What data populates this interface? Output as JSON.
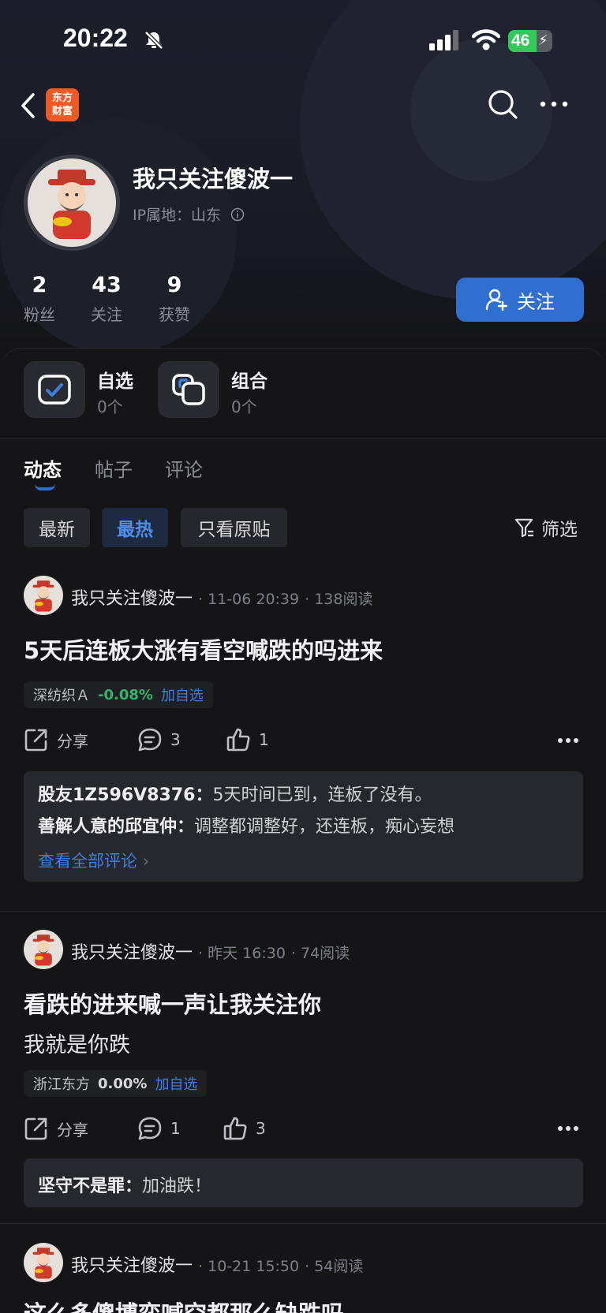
{
  "status_bar": {
    "time": "20:22",
    "battery": "46"
  },
  "nav": {
    "logo_line1": "东方",
    "logo_line2": "财富"
  },
  "profile": {
    "name": "我只关注傻波一",
    "ip_label": "IP属地：山东",
    "stats": [
      {
        "value": "2",
        "label": "粉丝"
      },
      {
        "value": "43",
        "label": "关注"
      },
      {
        "value": "9",
        "label": "获赞"
      }
    ],
    "follow_label": "关注"
  },
  "assets": [
    {
      "title": "自选",
      "count": "0个"
    },
    {
      "title": "组合",
      "count": "0个"
    }
  ],
  "tabs": [
    {
      "label": "动态",
      "active": true
    },
    {
      "label": "帖子",
      "active": false
    },
    {
      "label": "评论",
      "active": false
    }
  ],
  "chips": [
    {
      "label": "最新",
      "active": false
    },
    {
      "label": "最热",
      "active": true
    },
    {
      "label": "只看原贴",
      "active": false
    }
  ],
  "filter_label": "筛选",
  "posts": [
    {
      "author": "我只关注傻波一",
      "time": "11-06 20:39",
      "reads": "138阅读",
      "title": "5天后连板大涨有看空喊跌的吗进来",
      "stock_name": "深纺织Ａ",
      "stock_change": "-0.08%",
      "add_watch": "加自选",
      "share_label": "分享",
      "comments": "3",
      "likes": "1",
      "comment_list": [
        {
          "author": "股友1Z596V8376：",
          "text": "5天时间已到，连板了没有。"
        },
        {
          "author": "善解人意的邱宜仲：",
          "text": "调整都调整好，还连板，痴心妄想"
        }
      ],
      "view_all": "查看全部评论"
    },
    {
      "author": "我只关注傻波一",
      "time": "昨天 16:30",
      "reads": "74阅读",
      "title": "看跌的进来喊一声让我关注你",
      "body": "我就是你跌",
      "stock_name": "浙江东方",
      "stock_change": "0.00%",
      "add_watch": "加自选",
      "share_label": "分享",
      "comments": "1",
      "likes": "3",
      "comment_list": [
        {
          "author": "坚守不是罪：",
          "text": "加油跌！"
        }
      ]
    },
    {
      "author": "我只关注傻波一",
      "time": "10-21 15:50",
      "reads": "54阅读",
      "title": "这么多傻博弈喊空都那么缺跌吗"
    }
  ]
}
